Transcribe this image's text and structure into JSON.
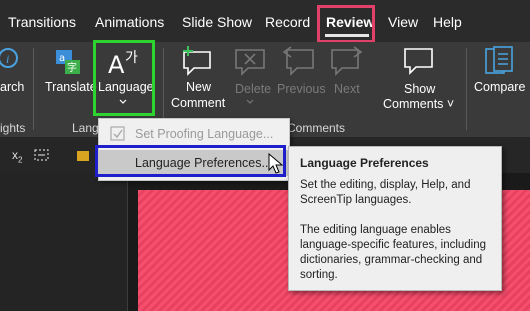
{
  "tabs": [
    {
      "label": "Transitions"
    },
    {
      "label": "Animations"
    },
    {
      "label": "Slide Show"
    },
    {
      "label": "Record"
    },
    {
      "label": "Review"
    },
    {
      "label": "View"
    },
    {
      "label": "Help"
    }
  ],
  "ribbon": {
    "search_label": "arch",
    "translate_label": "Translate",
    "language_label": "Language",
    "new_comment_line1": "New",
    "new_comment_line2": "Comment",
    "delete_label": "Delete",
    "previous_label": "Previous",
    "next_label": "Next",
    "show_comments_line1": "Show",
    "show_comments_line2": "Comments ˅",
    "compare_label": "Compare",
    "group_insights": "ights",
    "group_language": "Lang",
    "group_comments": "Comments"
  },
  "language_menu": {
    "items": [
      {
        "label": "Set Proofing Language...",
        "disabled": true
      },
      {
        "label": "Language Preferences...",
        "disabled": false
      }
    ]
  },
  "tooltip": {
    "title": "Language Preferences",
    "para1": "Set the editing, display, Help, and ScreenTip languages.",
    "para2": "The editing language enables language-specific features, including dictionaries, grammar-checking and sorting."
  },
  "colors": {
    "review_highlight": "#e0406a",
    "language_highlight": "#2fd32f",
    "preferences_highlight": "#1f1fcc",
    "slide": "#f4506e"
  }
}
